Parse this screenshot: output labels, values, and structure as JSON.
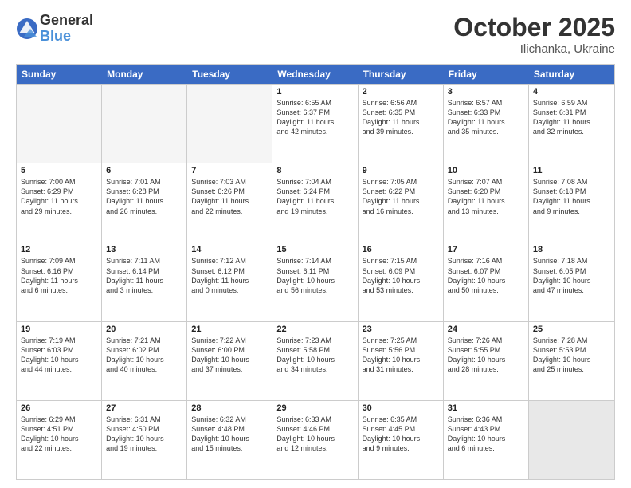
{
  "logo": {
    "general": "General",
    "blue": "Blue"
  },
  "title": "October 2025",
  "location": "Ilichanka, Ukraine",
  "weekdays": [
    "Sunday",
    "Monday",
    "Tuesday",
    "Wednesday",
    "Thursday",
    "Friday",
    "Saturday"
  ],
  "weeks": [
    [
      {
        "day": "",
        "info": "",
        "empty": true
      },
      {
        "day": "",
        "info": "",
        "empty": true
      },
      {
        "day": "",
        "info": "",
        "empty": true
      },
      {
        "day": "1",
        "info": "Sunrise: 6:55 AM\nSunset: 6:37 PM\nDaylight: 11 hours\nand 42 minutes."
      },
      {
        "day": "2",
        "info": "Sunrise: 6:56 AM\nSunset: 6:35 PM\nDaylight: 11 hours\nand 39 minutes."
      },
      {
        "day": "3",
        "info": "Sunrise: 6:57 AM\nSunset: 6:33 PM\nDaylight: 11 hours\nand 35 minutes."
      },
      {
        "day": "4",
        "info": "Sunrise: 6:59 AM\nSunset: 6:31 PM\nDaylight: 11 hours\nand 32 minutes."
      }
    ],
    [
      {
        "day": "5",
        "info": "Sunrise: 7:00 AM\nSunset: 6:29 PM\nDaylight: 11 hours\nand 29 minutes."
      },
      {
        "day": "6",
        "info": "Sunrise: 7:01 AM\nSunset: 6:28 PM\nDaylight: 11 hours\nand 26 minutes."
      },
      {
        "day": "7",
        "info": "Sunrise: 7:03 AM\nSunset: 6:26 PM\nDaylight: 11 hours\nand 22 minutes."
      },
      {
        "day": "8",
        "info": "Sunrise: 7:04 AM\nSunset: 6:24 PM\nDaylight: 11 hours\nand 19 minutes."
      },
      {
        "day": "9",
        "info": "Sunrise: 7:05 AM\nSunset: 6:22 PM\nDaylight: 11 hours\nand 16 minutes."
      },
      {
        "day": "10",
        "info": "Sunrise: 7:07 AM\nSunset: 6:20 PM\nDaylight: 11 hours\nand 13 minutes."
      },
      {
        "day": "11",
        "info": "Sunrise: 7:08 AM\nSunset: 6:18 PM\nDaylight: 11 hours\nand 9 minutes."
      }
    ],
    [
      {
        "day": "12",
        "info": "Sunrise: 7:09 AM\nSunset: 6:16 PM\nDaylight: 11 hours\nand 6 minutes."
      },
      {
        "day": "13",
        "info": "Sunrise: 7:11 AM\nSunset: 6:14 PM\nDaylight: 11 hours\nand 3 minutes."
      },
      {
        "day": "14",
        "info": "Sunrise: 7:12 AM\nSunset: 6:12 PM\nDaylight: 11 hours\nand 0 minutes."
      },
      {
        "day": "15",
        "info": "Sunrise: 7:14 AM\nSunset: 6:11 PM\nDaylight: 10 hours\nand 56 minutes."
      },
      {
        "day": "16",
        "info": "Sunrise: 7:15 AM\nSunset: 6:09 PM\nDaylight: 10 hours\nand 53 minutes."
      },
      {
        "day": "17",
        "info": "Sunrise: 7:16 AM\nSunset: 6:07 PM\nDaylight: 10 hours\nand 50 minutes."
      },
      {
        "day": "18",
        "info": "Sunrise: 7:18 AM\nSunset: 6:05 PM\nDaylight: 10 hours\nand 47 minutes."
      }
    ],
    [
      {
        "day": "19",
        "info": "Sunrise: 7:19 AM\nSunset: 6:03 PM\nDaylight: 10 hours\nand 44 minutes."
      },
      {
        "day": "20",
        "info": "Sunrise: 7:21 AM\nSunset: 6:02 PM\nDaylight: 10 hours\nand 40 minutes."
      },
      {
        "day": "21",
        "info": "Sunrise: 7:22 AM\nSunset: 6:00 PM\nDaylight: 10 hours\nand 37 minutes."
      },
      {
        "day": "22",
        "info": "Sunrise: 7:23 AM\nSunset: 5:58 PM\nDaylight: 10 hours\nand 34 minutes."
      },
      {
        "day": "23",
        "info": "Sunrise: 7:25 AM\nSunset: 5:56 PM\nDaylight: 10 hours\nand 31 minutes."
      },
      {
        "day": "24",
        "info": "Sunrise: 7:26 AM\nSunset: 5:55 PM\nDaylight: 10 hours\nand 28 minutes."
      },
      {
        "day": "25",
        "info": "Sunrise: 7:28 AM\nSunset: 5:53 PM\nDaylight: 10 hours\nand 25 minutes."
      }
    ],
    [
      {
        "day": "26",
        "info": "Sunrise: 6:29 AM\nSunset: 4:51 PM\nDaylight: 10 hours\nand 22 minutes."
      },
      {
        "day": "27",
        "info": "Sunrise: 6:31 AM\nSunset: 4:50 PM\nDaylight: 10 hours\nand 19 minutes."
      },
      {
        "day": "28",
        "info": "Sunrise: 6:32 AM\nSunset: 4:48 PM\nDaylight: 10 hours\nand 15 minutes."
      },
      {
        "day": "29",
        "info": "Sunrise: 6:33 AM\nSunset: 4:46 PM\nDaylight: 10 hours\nand 12 minutes."
      },
      {
        "day": "30",
        "info": "Sunrise: 6:35 AM\nSunset: 4:45 PM\nDaylight: 10 hours\nand 9 minutes."
      },
      {
        "day": "31",
        "info": "Sunrise: 6:36 AM\nSunset: 4:43 PM\nDaylight: 10 hours\nand 6 minutes."
      },
      {
        "day": "",
        "info": "",
        "empty": true,
        "shaded": true
      }
    ]
  ]
}
